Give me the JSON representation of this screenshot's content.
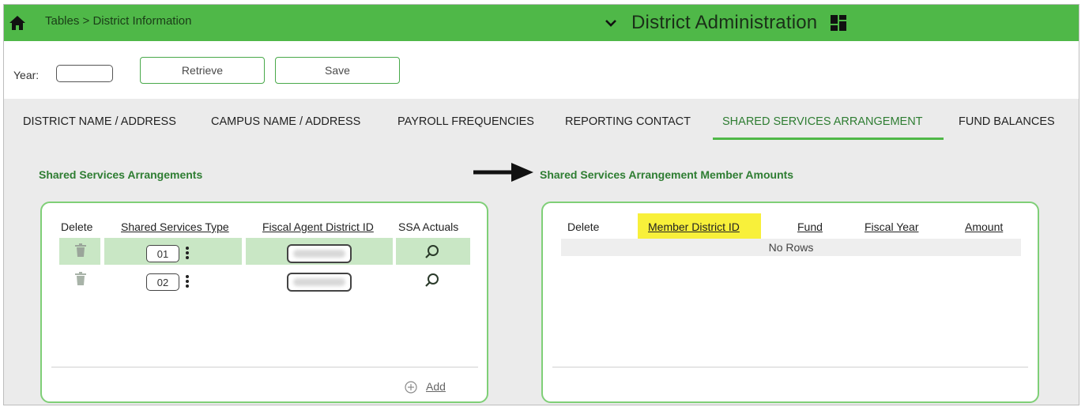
{
  "header": {
    "breadcrumb": "Tables > District Information",
    "app_title": "District Administration",
    "accent": "#4fb848"
  },
  "toolbar": {
    "year_label": "Year:",
    "year_value": "",
    "retrieve_label": "Retrieve",
    "save_label": "Save"
  },
  "tabs": [
    {
      "label": "DISTRICT NAME / ADDRESS",
      "active": false
    },
    {
      "label": "CAMPUS NAME / ADDRESS",
      "active": false
    },
    {
      "label": "PAYROLL FREQUENCIES",
      "active": false
    },
    {
      "label": "REPORTING CONTACT",
      "active": false
    },
    {
      "label": "SHARED SERVICES ARRANGEMENT",
      "active": true
    },
    {
      "label": "FUND BALANCES",
      "active": false
    }
  ],
  "left_section": {
    "title": "Shared Services Arrangements",
    "columns": [
      "Delete",
      "Shared Services Type",
      "Fiscal Agent District ID",
      "SSA Actuals"
    ],
    "rows": [
      {
        "type_code": "01",
        "selected": true
      },
      {
        "type_code": "02",
        "selected": false
      }
    ],
    "add_label": "Add"
  },
  "right_section": {
    "title": "Shared Services Arrangement Member Amounts",
    "columns": [
      "Delete",
      "Member District ID",
      "Fund",
      "Fiscal Year",
      "Amount"
    ],
    "empty_text": "No Rows"
  },
  "icons": {
    "home": "home-icon",
    "chevron": "chevron-down-icon",
    "grid": "grid-icon",
    "arrow": "arrow-right-icon",
    "trash": "trash-icon",
    "kebab": "kebab-menu-icon",
    "search": "search-icon",
    "add": "add-circle-icon"
  },
  "colors": {
    "selected_row": "#c9e7c5",
    "highlight": "#f8f03a",
    "link_green": "#2e7d32"
  }
}
